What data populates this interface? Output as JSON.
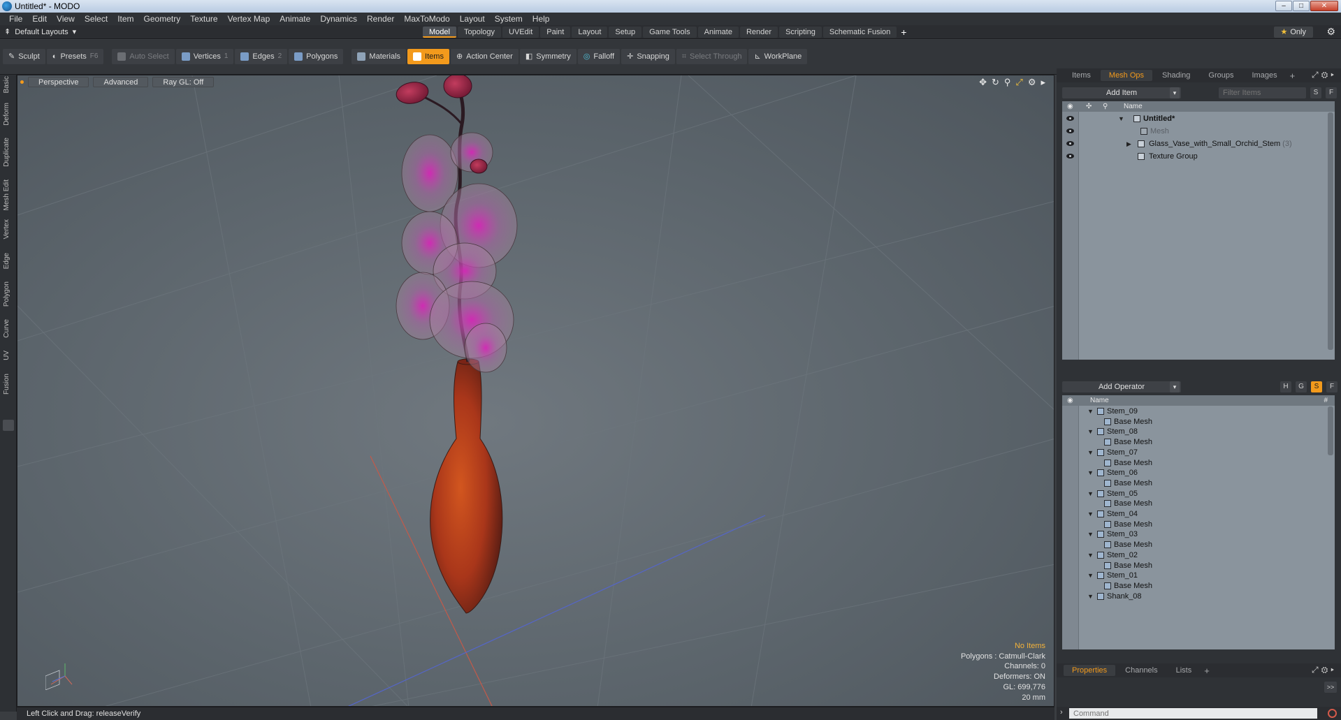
{
  "window": {
    "title": "Untitled* - MODO",
    "minimize": "–",
    "maximize": "□",
    "close": "✕"
  },
  "menu": [
    "File",
    "Edit",
    "View",
    "Select",
    "Item",
    "Geometry",
    "Texture",
    "Vertex Map",
    "Animate",
    "Dynamics",
    "Render",
    "MaxToModo",
    "Layout",
    "System",
    "Help"
  ],
  "layout_bar": {
    "layout_name": "Default Layouts",
    "tabs": [
      "Model",
      "Topology",
      "UVEdit",
      "Paint",
      "Layout",
      "Setup",
      "Game Tools",
      "Animate",
      "Render",
      "Scripting",
      "Schematic Fusion"
    ],
    "active_tab": "Model",
    "add": "+",
    "only_label": "Only"
  },
  "toolbar": {
    "sculpt": "Sculpt",
    "presets": "Presets",
    "presets_key": "F6",
    "auto_select": "Auto Select",
    "vertices": "Vertices",
    "vertices_key": "1",
    "edges": "Edges",
    "edges_key": "2",
    "polygons": "Polygons",
    "materials": "Materials",
    "items": "Items",
    "action_center": "Action Center",
    "symmetry": "Symmetry",
    "falloff": "Falloff",
    "snapping": "Snapping",
    "select_through": "Select Through",
    "workplane": "WorkPlane"
  },
  "left_strip": [
    "Basic",
    "Deform",
    "Duplicate",
    "Mesh Edit",
    "Vertex",
    "Edge",
    "Polygon",
    "Curve",
    "UV",
    "Fusion"
  ],
  "viewport": {
    "view": "Perspective",
    "mode": "Advanced",
    "raygl": "Ray GL: Off",
    "stats": {
      "no_items": "No Items",
      "polygons": "Polygons : Catmull-Clark",
      "channels": "Channels: 0",
      "deformers": "Deformers: ON",
      "gl": "GL: 699,776",
      "size": "20 mm"
    }
  },
  "status": {
    "text": "Left Click and Drag:  releaseVerify"
  },
  "item_panel": {
    "tabs": [
      "Items",
      "Mesh Ops",
      "Shading",
      "Groups",
      "Images"
    ],
    "active_tab": "Mesh Ops",
    "add_item": "Add Item",
    "filter_placeholder": "Filter Items",
    "s": "S",
    "f": "F",
    "name_header": "Name",
    "rows": [
      {
        "label": "Untitled*",
        "count": ""
      },
      {
        "label": "Mesh",
        "count": ""
      },
      {
        "label": "Glass_Vase_with_Small_Orchid_Stem",
        "count": "(3)"
      },
      {
        "label": "Texture Group",
        "count": ""
      }
    ]
  },
  "operator_panel": {
    "add_operator": "Add Operator",
    "h": "H",
    "g": "G",
    "s": "S",
    "f": "F",
    "name_header": "Name",
    "hash_header": "#",
    "rows": [
      {
        "label": "Stem_09"
      },
      {
        "label": "Base Mesh"
      },
      {
        "label": "Stem_08"
      },
      {
        "label": "Base Mesh"
      },
      {
        "label": "Stem_07"
      },
      {
        "label": "Base Mesh"
      },
      {
        "label": "Stem_06"
      },
      {
        "label": "Base Mesh"
      },
      {
        "label": "Stem_05"
      },
      {
        "label": "Base Mesh"
      },
      {
        "label": "Stem_04"
      },
      {
        "label": "Base Mesh"
      },
      {
        "label": "Stem_03"
      },
      {
        "label": "Base Mesh"
      },
      {
        "label": "Stem_02"
      },
      {
        "label": "Base Mesh"
      },
      {
        "label": "Stem_01"
      },
      {
        "label": "Base Mesh"
      },
      {
        "label": "Shank_08"
      }
    ]
  },
  "properties_panel": {
    "tabs": [
      "Properties",
      "Channels",
      "Lists"
    ],
    "active_tab": "Properties",
    "expand": ">>"
  },
  "command": {
    "placeholder": "Command"
  },
  "colors": {
    "accent": "#f39a1c",
    "vase": "#b8401c",
    "orchid": "#c23aa8"
  }
}
